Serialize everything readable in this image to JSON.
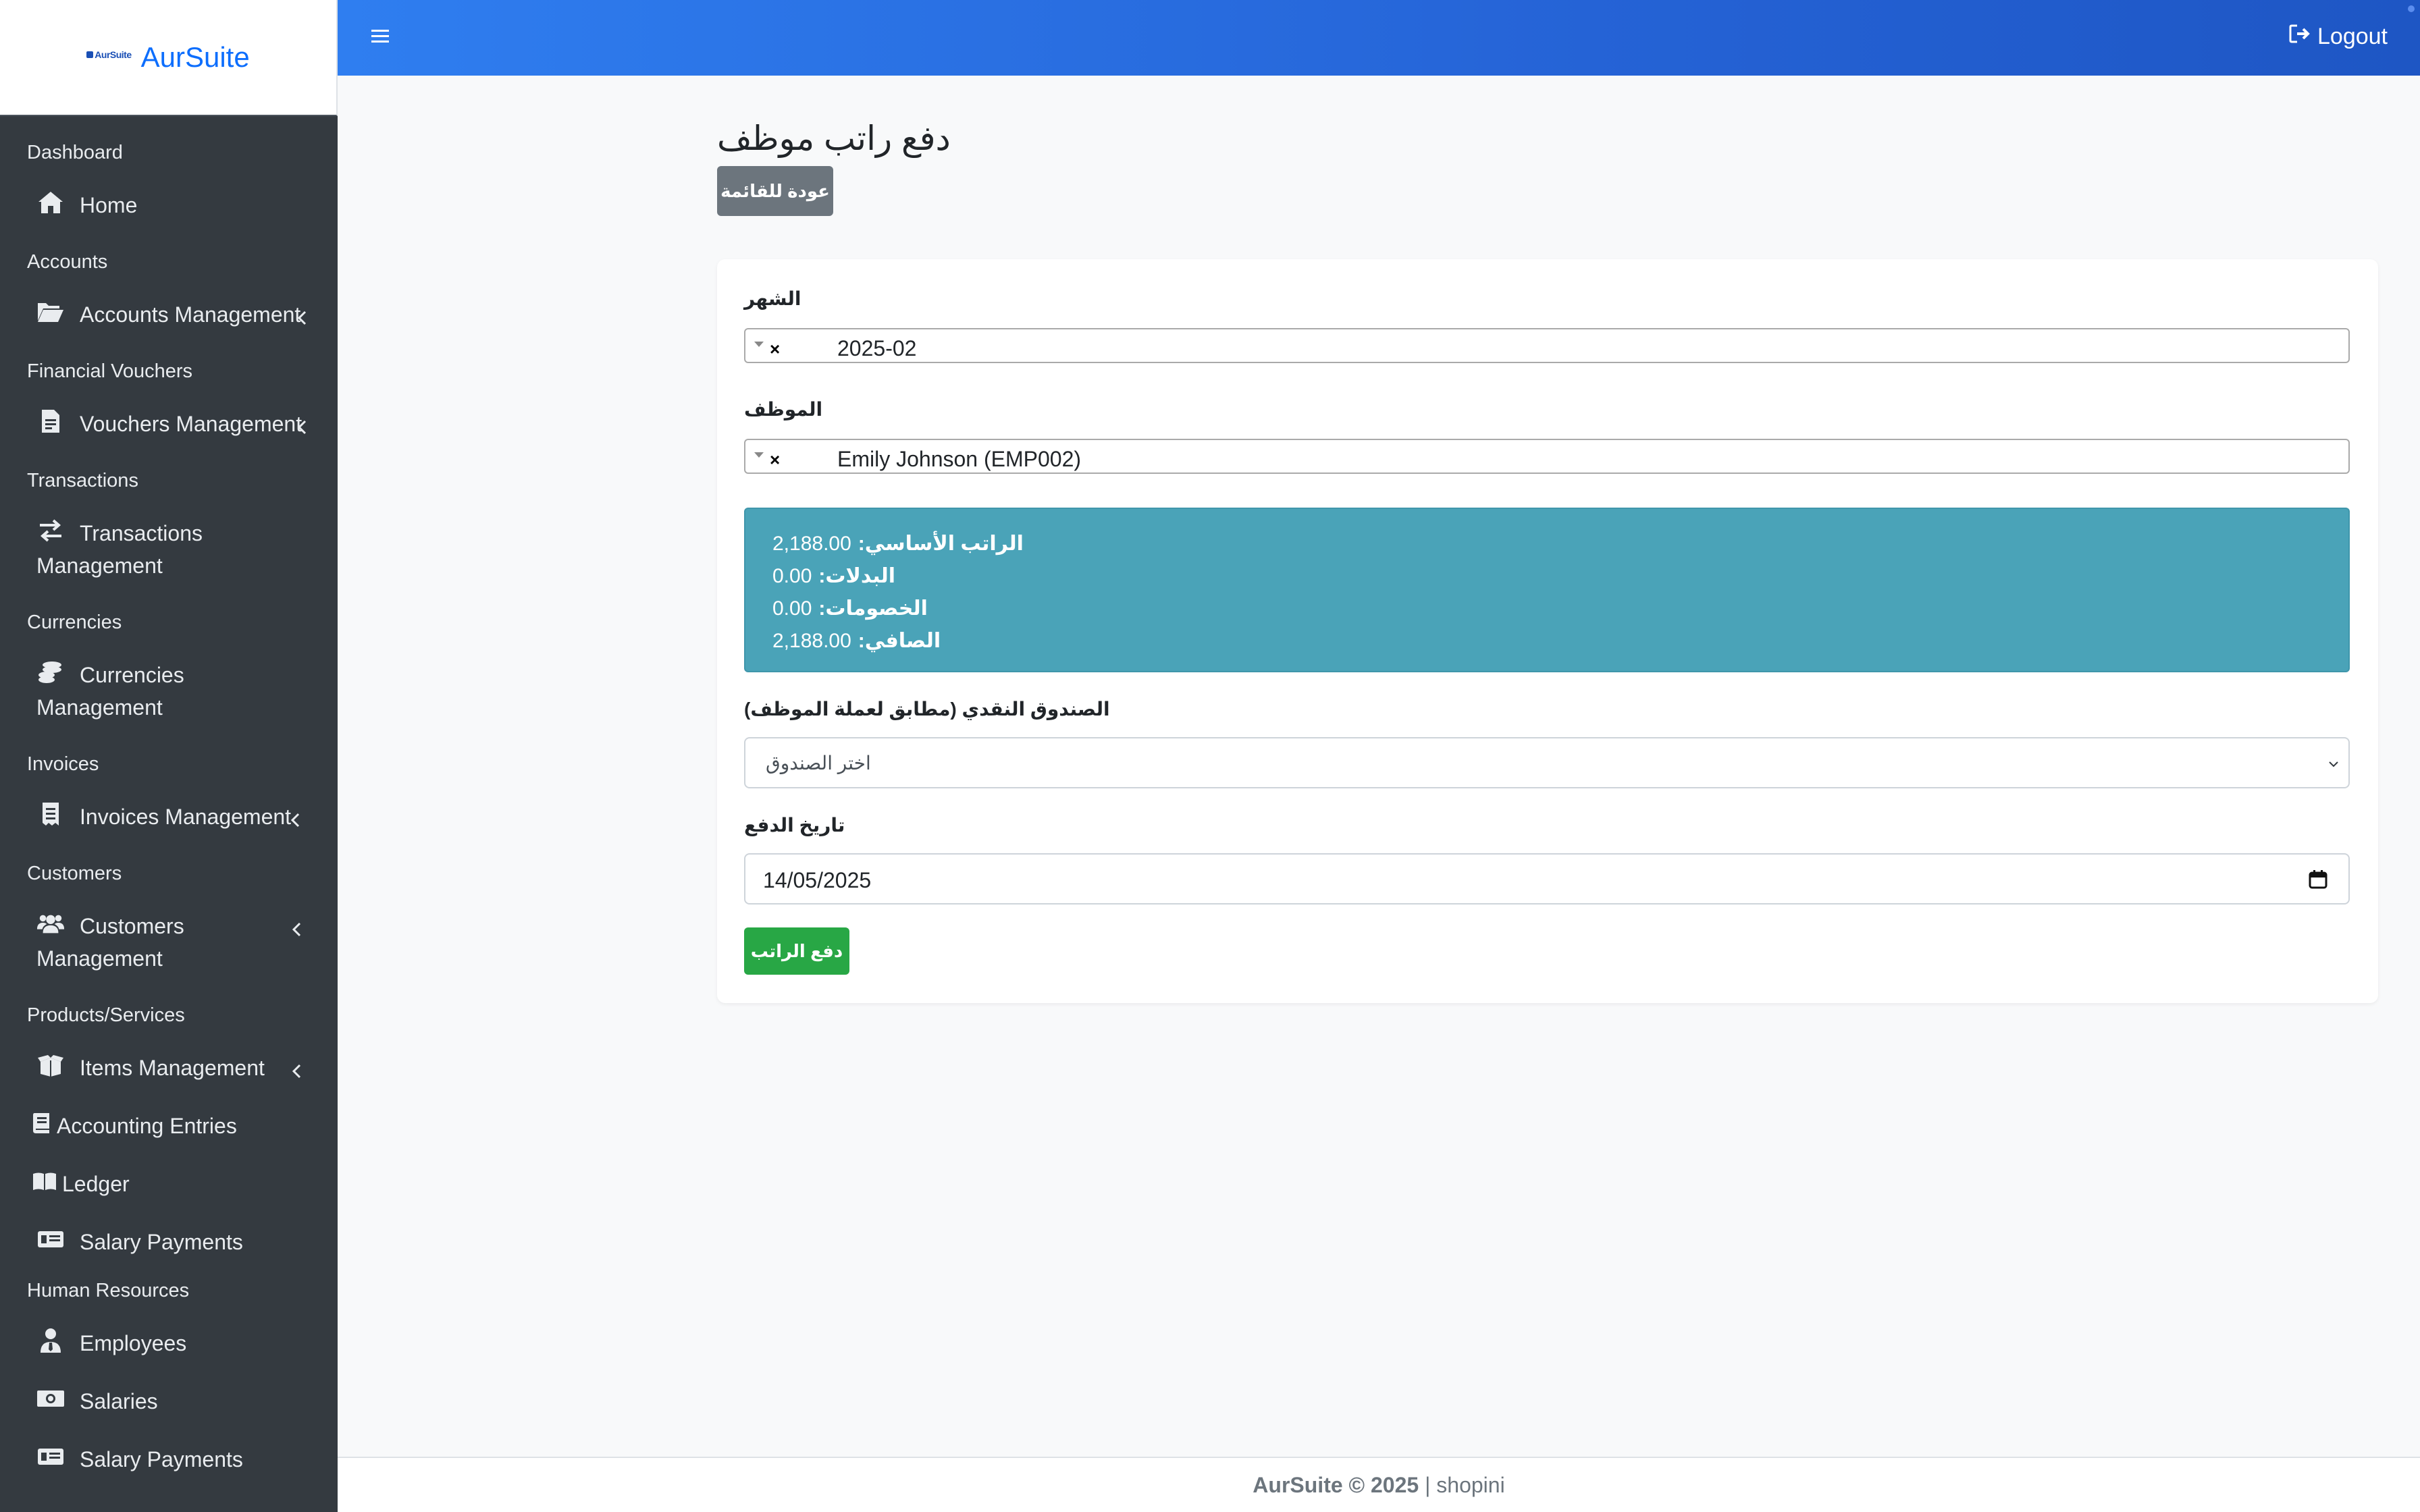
{
  "brand": {
    "logo_text": "AurSuite",
    "name": "AurSuite"
  },
  "topbar": {
    "logout_label": "Logout"
  },
  "sidebar": {
    "sections": [
      {
        "header": "Dashboard",
        "items": [
          {
            "label": "Home",
            "icon": "home-icon"
          }
        ]
      },
      {
        "header": "Accounts",
        "items": [
          {
            "label": "Accounts Management",
            "icon": "folder-open-icon"
          }
        ]
      },
      {
        "header": "Financial Vouchers",
        "items": [
          {
            "label": "Vouchers Management",
            "icon": "file-invoice-icon"
          }
        ]
      },
      {
        "header": "Transactions",
        "items": [
          {
            "label_line1": "Transactions",
            "label_line2": "Management",
            "icon": "exchange-icon"
          }
        ]
      },
      {
        "header": "Currencies",
        "items": [
          {
            "label_line1": "Currencies",
            "label_line2": "Management",
            "icon": "coins-icon"
          }
        ]
      },
      {
        "header": "Invoices",
        "items": [
          {
            "label": "Invoices Management",
            "icon": "receipt-icon"
          }
        ]
      },
      {
        "header": "Customers",
        "items": [
          {
            "label_line1": "Customers",
            "label_line2": "Management",
            "icon": "users-icon"
          }
        ]
      },
      {
        "header": "Products/Services",
        "items": [
          {
            "label": "Items Management",
            "icon": "box-open-icon"
          },
          {
            "label": "Accounting Entries",
            "icon": "book-icon"
          },
          {
            "label": "Ledger",
            "icon": "book-open-icon"
          },
          {
            "label": "Salary Payments",
            "icon": "money-check-icon"
          }
        ]
      },
      {
        "header": "Human Resources",
        "items": [
          {
            "label": "Employees",
            "icon": "user-tie-icon"
          },
          {
            "label": "Salaries",
            "icon": "money-bill-icon"
          },
          {
            "label": "Salary Payments",
            "icon": "money-check-icon"
          }
        ]
      }
    ]
  },
  "page": {
    "title": "دفع راتب موظف",
    "back_label": "عودة للقائمة"
  },
  "form": {
    "month_label": "الشهر",
    "month_value": "2025-02",
    "employee_label": "الموظف",
    "employee_value": "Emily Johnson (EMP002)",
    "summary": {
      "basic_label": "الراتب الأساسي:",
      "basic_value": "2,188.00",
      "allowances_label": "البدلات:",
      "allowances_value": "0.00",
      "deductions_label": "الخصومات:",
      "deductions_value": "0.00",
      "net_label": "الصافي:",
      "net_value": "2,188.00"
    },
    "cashbox_label": "الصندوق النقدي (مطابق لعملة الموظف)",
    "cashbox_placeholder": "اختر الصندوق",
    "date_label": "تاريخ الدفع",
    "date_value": "14/05/2025",
    "submit_label": "دفع الراتب"
  },
  "footer": {
    "brand": "AurSuite © 2025",
    "separator": " | ",
    "owner": "shopini"
  },
  "colors": {
    "sidebar_bg": "#343a40",
    "topbar": "#2f7ef0",
    "info": "#4aa3b8",
    "success": "#28a745",
    "secondary": "#6c757d"
  }
}
